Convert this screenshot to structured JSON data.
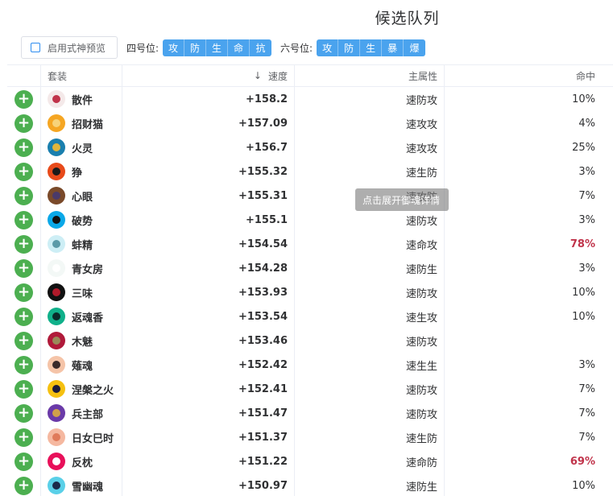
{
  "title": "候选队列",
  "toolbar": {
    "preview_label": "启用式神预览",
    "pos4_label": "四号位:",
    "pos4_buttons": [
      "攻",
      "防",
      "生",
      "命",
      "抗"
    ],
    "pos6_label": "六号位:",
    "pos6_buttons": [
      "攻",
      "防",
      "生",
      "暴",
      "爆"
    ]
  },
  "table": {
    "headers": {
      "set": "套装",
      "speed": "速度",
      "main": "主属性",
      "hit": "命中"
    },
    "rows": [
      {
        "add": "+",
        "name": "散件",
        "speed": "+158.2",
        "main": "速防攻",
        "hit": "10%",
        "bg": "#f4e9e9",
        "dot": "#c0334a",
        "hit_color": "normal"
      },
      {
        "add": "+",
        "name": "招财猫",
        "speed": "+157.09",
        "main": "速攻攻",
        "hit": "4%",
        "bg": "#f5a623",
        "dot": "#f7d37a",
        "hit_color": "normal"
      },
      {
        "add": "+",
        "name": "火灵",
        "speed": "+156.7",
        "main": "速攻攻",
        "hit": "25%",
        "bg": "#1a7fae",
        "dot": "#e0b53a",
        "hit_color": "normal"
      },
      {
        "add": "+",
        "name": "狰",
        "speed": "+155.32",
        "main": "速生防",
        "hit": "3%",
        "bg": "#e84a1a",
        "dot": "#1a1a1a",
        "hit_color": "normal"
      },
      {
        "add": "+",
        "name": "心眼",
        "speed": "+155.31",
        "main": "速攻防",
        "hit": "7%",
        "bg": "#7a4a2a",
        "dot": "#4a3a6a",
        "hit_color": "normal"
      },
      {
        "add": "+",
        "name": "破势",
        "speed": "+155.1",
        "main": "速防攻",
        "hit": "3%",
        "bg": "#0aa8e8",
        "dot": "#111111",
        "hit_color": "normal"
      },
      {
        "add": "+",
        "name": "蚌精",
        "speed": "+154.54",
        "main": "速命攻",
        "hit": "78%",
        "bg": "#cdeef5",
        "dot": "#5a9aa8",
        "hit_color": "red"
      },
      {
        "add": "+",
        "name": "青女房",
        "speed": "+154.28",
        "main": "速防生",
        "hit": "3%",
        "bg": "#f3f8f6",
        "dot": "#ffffff",
        "hit_color": "normal"
      },
      {
        "add": "+",
        "name": "三味",
        "speed": "+153.93",
        "main": "速防攻",
        "hit": "10%",
        "bg": "#111111",
        "dot": "#b01a2a",
        "hit_color": "normal"
      },
      {
        "add": "+",
        "name": "返魂香",
        "speed": "+153.54",
        "main": "速生攻",
        "hit": "10%",
        "bg": "#10b08a",
        "dot": "#0a2a2a",
        "hit_color": "normal"
      },
      {
        "add": "+",
        "name": "木魅",
        "speed": "+153.46",
        "main": "速防攻",
        "hit": "",
        "bg": "#b01a3a",
        "dot": "#9a8a5a",
        "hit_color": "normal"
      },
      {
        "add": "+",
        "name": "薙魂",
        "speed": "+152.42",
        "main": "速生生",
        "hit": "3%",
        "bg": "#f5c4a8",
        "dot": "#3a2a2a",
        "hit_color": "normal"
      },
      {
        "add": "+",
        "name": "涅槃之火",
        "speed": "+152.41",
        "main": "速防攻",
        "hit": "7%",
        "bg": "#f5c010",
        "dot": "#1a1a3a",
        "hit_color": "normal"
      },
      {
        "add": "+",
        "name": "兵主部",
        "speed": "+151.47",
        "main": "速防攻",
        "hit": "7%",
        "bg": "#6a3aa8",
        "dot": "#d0a04a",
        "hit_color": "normal"
      },
      {
        "add": "+",
        "name": "日女巳时",
        "speed": "+151.37",
        "main": "速生防",
        "hit": "7%",
        "bg": "#f5b8a0",
        "dot": "#e07a5a",
        "hit_color": "normal"
      },
      {
        "add": "+",
        "name": "反枕",
        "speed": "+151.22",
        "main": "速命防",
        "hit": "69%",
        "bg": "#e8105a",
        "dot": "#ffffff",
        "hit_color": "red"
      },
      {
        "add": "+",
        "name": "雪幽魂",
        "speed": "+150.97",
        "main": "速防生",
        "hit": "10%",
        "bg": "#5ad0e8",
        "dot": "#1a2a4a",
        "hit_color": "normal"
      }
    ]
  },
  "tooltip": "点击展开御魂详情"
}
